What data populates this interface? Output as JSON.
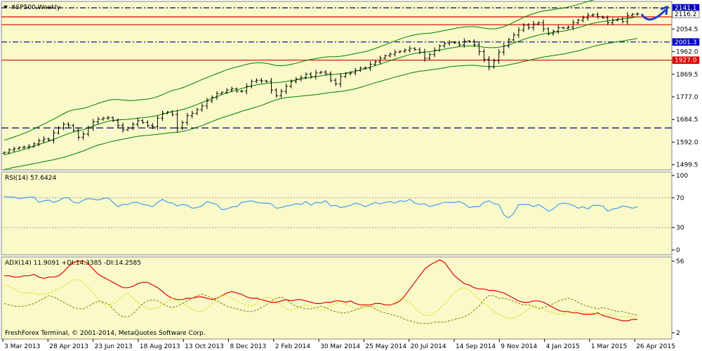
{
  "chart_data": [
    {
      "type": "ohlc",
      "title": "#SP500,Weekly",
      "y_ticks": [
        "2054.5",
        "1962.0",
        "1869.5",
        "1777.0",
        "1684.5",
        "1592.0",
        "1499.5"
      ],
      "ylim": [
        1490,
        2150
      ],
      "price_tags": [
        {
          "text": "2141.1",
          "value": 2141.1,
          "bg": "#0000c8",
          "fg": "#ffffff"
        },
        {
          "text": "2116.2",
          "value": 2116.2,
          "bg": "#ffffff",
          "fg": "#000000"
        },
        {
          "text": "2001.3",
          "value": 2001.3,
          "bg": "#0000c8",
          "fg": "#ffffff"
        },
        {
          "text": "1927.0",
          "value": 1927.0,
          "bg": "#e00000",
          "fg": "#ffffff"
        }
      ],
      "hlines": [
        {
          "value": 2141.1,
          "color": "#000080",
          "dash": "dashdot"
        },
        {
          "value": 2104.0,
          "color": "#e00000",
          "dash": "solid"
        },
        {
          "value": 2072.0,
          "color": "#e00000",
          "dash": "solid"
        },
        {
          "value": 2001.3,
          "color": "#000080",
          "dash": "dashdot"
        },
        {
          "value": 1927.0,
          "color": "#e00000",
          "dash": "solid"
        },
        {
          "value": 1650.0,
          "color": "#000080",
          "dash": "dash"
        }
      ],
      "close": [
        1550,
        1560,
        1565,
        1570,
        1572,
        1575,
        1585,
        1598,
        1605,
        1600,
        1630,
        1650,
        1665,
        1660,
        1640,
        1612,
        1625,
        1650,
        1675,
        1685,
        1690,
        1692,
        1680,
        1660,
        1642,
        1650,
        1665,
        1680,
        1672,
        1660,
        1655,
        1690,
        1710,
        1715,
        1705,
        1650,
        1672,
        1700,
        1710,
        1725,
        1740,
        1760,
        1775,
        1790,
        1796,
        1805,
        1810,
        1800,
        1800,
        1820,
        1840,
        1845,
        1842,
        1840,
        1805,
        1782,
        1800,
        1820,
        1840,
        1850,
        1856,
        1870,
        1860,
        1875,
        1878,
        1872,
        1845,
        1830,
        1860,
        1872,
        1875,
        1885,
        1895,
        1895,
        1910,
        1920,
        1935,
        1945,
        1952,
        1960,
        1963,
        1968,
        1975,
        1970,
        1960,
        1935,
        1950,
        1968,
        1985,
        1995,
        2000,
        1998,
        1990,
        2005,
        2003,
        1990,
        1962,
        1930,
        1900,
        1925,
        1960,
        1985,
        2010,
        2030,
        2050,
        2070,
        2060,
        2075,
        2080,
        2055,
        2035,
        2045,
        2060,
        2058,
        2062,
        2080,
        2090,
        2100,
        2110,
        2113,
        2105,
        2100,
        2080,
        2090,
        2095,
        2085,
        2110,
        2115,
        2116
      ],
      "bb_mid": [
        1540,
        1545,
        1551,
        1556,
        1562,
        1568,
        1575,
        1582,
        1589,
        1596,
        1603,
        1611,
        1619,
        1627,
        1633,
        1638,
        1643,
        1650,
        1658,
        1665,
        1671,
        1677,
        1681,
        1683,
        1684,
        1685,
        1687,
        1690,
        1692,
        1694,
        1697,
        1701,
        1706,
        1712,
        1717,
        1720,
        1725,
        1731,
        1738,
        1746,
        1754,
        1762,
        1770,
        1778,
        1786,
        1793,
        1799,
        1805,
        1811,
        1817,
        1822,
        1826,
        1829,
        1832,
        1834,
        1835,
        1837,
        1840,
        1843,
        1846,
        1850,
        1854,
        1857,
        1860,
        1863,
        1866,
        1868,
        1869,
        1871,
        1874,
        1878,
        1882,
        1887,
        1892,
        1898,
        1905,
        1911,
        1918,
        1925,
        1932,
        1938,
        1944,
        1950,
        1954,
        1958,
        1960,
        1962,
        1965,
        1968,
        1972,
        1976,
        1979,
        1982,
        1984,
        1985,
        1985,
        1983,
        1980,
        1978,
        1978,
        1980,
        1984,
        1990,
        1997,
        2004,
        2012,
        2018,
        2024,
        2030,
        2034,
        2037,
        2040,
        2043,
        2046,
        2050,
        2055,
        2060,
        2066,
        2072,
        2078,
        2082,
        2085,
        2088,
        2090,
        2093,
        2095,
        2098,
        2101,
        2104
      ],
      "bb_upper": [
        1600,
        1606,
        1613,
        1620,
        1628,
        1636,
        1646,
        1656,
        1666,
        1676,
        1686,
        1697,
        1708,
        1718,
        1724,
        1727,
        1730,
        1736,
        1743,
        1750,
        1757,
        1763,
        1766,
        1766,
        1764,
        1762,
        1762,
        1764,
        1766,
        1768,
        1772,
        1778,
        1786,
        1795,
        1803,
        1808,
        1814,
        1822,
        1830,
        1839,
        1848,
        1856,
        1864,
        1872,
        1880,
        1888,
        1894,
        1899,
        1904,
        1910,
        1914,
        1916,
        1916,
        1914,
        1910,
        1905,
        1904,
        1906,
        1910,
        1914,
        1920,
        1926,
        1930,
        1934,
        1937,
        1940,
        1941,
        1941,
        1943,
        1946,
        1950,
        1954,
        1958,
        1962,
        1968,
        1975,
        1982,
        1990,
        1998,
        2006,
        2013,
        2020,
        2026,
        2030,
        2034,
        2036,
        2037,
        2040,
        2044,
        2048,
        2052,
        2056,
        2060,
        2063,
        2064,
        2064,
        2062,
        2058,
        2055,
        2055,
        2058,
        2064,
        2072,
        2082,
        2092,
        2102,
        2110,
        2117,
        2124,
        2128,
        2131,
        2134,
        2137,
        2140,
        2144,
        2149,
        2155,
        2161,
        2167,
        2173,
        2176,
        2178,
        2180,
        2181,
        2183,
        2185,
        2187,
        2190,
        2192
      ],
      "bb_lower": [
        1480,
        1484,
        1489,
        1492,
        1496,
        1500,
        1504,
        1508,
        1512,
        1516,
        1520,
        1525,
        1530,
        1536,
        1542,
        1549,
        1556,
        1564,
        1573,
        1580,
        1585,
        1591,
        1596,
        1600,
        1604,
        1608,
        1612,
        1616,
        1618,
        1620,
        1622,
        1624,
        1626,
        1629,
        1631,
        1632,
        1636,
        1640,
        1646,
        1653,
        1660,
        1668,
        1676,
        1684,
        1692,
        1698,
        1704,
        1711,
        1718,
        1724,
        1730,
        1736,
        1742,
        1750,
        1758,
        1765,
        1770,
        1774,
        1776,
        1778,
        1780,
        1782,
        1784,
        1786,
        1789,
        1792,
        1795,
        1797,
        1799,
        1802,
        1806,
        1810,
        1816,
        1822,
        1828,
        1835,
        1840,
        1846,
        1852,
        1858,
        1863,
        1868,
        1874,
        1878,
        1882,
        1884,
        1887,
        1890,
        1892,
        1896,
        1900,
        1902,
        1904,
        1905,
        1906,
        1906,
        1904,
        1902,
        1901,
        1901,
        1902,
        1904,
        1908,
        1912,
        1916,
        1922,
        1926,
        1931,
        1936,
        1940,
        1943,
        1946,
        1949,
        1952,
        1956,
        1961,
        1965,
        1971,
        1977,
        1983,
        1988,
        1992,
        1996,
        1999,
        2003,
        2005,
        2009,
        2012,
        2016
      ]
    },
    {
      "type": "line",
      "title": "RSI(14) 57.6424",
      "ylim": [
        0,
        100
      ],
      "y_ticks": [
        "100",
        "70",
        "30",
        "0"
      ],
      "levels": [
        70,
        30
      ],
      "series": [
        {
          "values": [
            72,
            71,
            71,
            69,
            70,
            71,
            71,
            64,
            66,
            67,
            64,
            66,
            70,
            70,
            64,
            63,
            67,
            69,
            68,
            67,
            69,
            70,
            64,
            58,
            61,
            61,
            64,
            64,
            61,
            60,
            58,
            64,
            68,
            64,
            63,
            59,
            61,
            60,
            56,
            57,
            59,
            65,
            63,
            61,
            54,
            55,
            58,
            58,
            64,
            65,
            66,
            64,
            63,
            63,
            62,
            56,
            57,
            59,
            60,
            62,
            61,
            65,
            60,
            64,
            63,
            66,
            59,
            60,
            57,
            58,
            60,
            63,
            61,
            58,
            61,
            64,
            62,
            64,
            65,
            63,
            66,
            65,
            68,
            63,
            61,
            62,
            58,
            60,
            62,
            64,
            64,
            64,
            65,
            62,
            57,
            58,
            58,
            64,
            66,
            62,
            61,
            47,
            43,
            49,
            61,
            61,
            61,
            58,
            61,
            57,
            52,
            55,
            61,
            63,
            62,
            60,
            56,
            58,
            55,
            60,
            60,
            59,
            52,
            55,
            56,
            59,
            58,
            56,
            58
          ]
        }
      ]
    },
    {
      "type": "line",
      "title": "ADX(14) 11.9091 +DI:14.3385 -DI:14.2585",
      "ylim": [
        2,
        56
      ],
      "y_ticks": [
        "56",
        "2"
      ],
      "series": [
        {
          "values": [
            45,
            45,
            44,
            44,
            45,
            45,
            46,
            44,
            43,
            44,
            44,
            45,
            48,
            52,
            55,
            56,
            56,
            54,
            50,
            46,
            44,
            42,
            40,
            38,
            36,
            36,
            37,
            39,
            40,
            40,
            38,
            36,
            33,
            30,
            28,
            27,
            27,
            28,
            28,
            29,
            29,
            28,
            27,
            28,
            30,
            32,
            33,
            32,
            31,
            29,
            28,
            28,
            27,
            26,
            25,
            25,
            26,
            27,
            26,
            27,
            27,
            26,
            25,
            24,
            24,
            25,
            25,
            26,
            26,
            25,
            26,
            24,
            23,
            23,
            23,
            24,
            24,
            23,
            23,
            24,
            26,
            30,
            35,
            40,
            45,
            50,
            53,
            55,
            57,
            55,
            50,
            45,
            42,
            39,
            38,
            36,
            35,
            35,
            34,
            34,
            33,
            32,
            30,
            28,
            26,
            25,
            25,
            26,
            26,
            25,
            23,
            21,
            19,
            18,
            18,
            17,
            17,
            16,
            16,
            16,
            17,
            15,
            14,
            13,
            12,
            11,
            11,
            12,
            12
          ],
          "color": "#e00000",
          "dash": "solid"
        },
        {
          "values": [
            38,
            37,
            35,
            33,
            32,
            32,
            32,
            31,
            31,
            32,
            33,
            35,
            37,
            40,
            42,
            42,
            40,
            36,
            32,
            27,
            24,
            22,
            24,
            26,
            30,
            32,
            28,
            25,
            22,
            20,
            20,
            21,
            23,
            26,
            28,
            26,
            24,
            22,
            20,
            18,
            18,
            20,
            24,
            28,
            30,
            30,
            28,
            26,
            24,
            23,
            22,
            24,
            27,
            29,
            28,
            26,
            23,
            20,
            19,
            20,
            22,
            23,
            22,
            20,
            19,
            20,
            22,
            24,
            25,
            23,
            22,
            20,
            20,
            21,
            22,
            22,
            21,
            20,
            22,
            26,
            28,
            27,
            25,
            21,
            17,
            15,
            15,
            17,
            20,
            24,
            28,
            32,
            35,
            36,
            34,
            31,
            27,
            24,
            21,
            18,
            16,
            14,
            13,
            13,
            15,
            17,
            20,
            22,
            22,
            20,
            18,
            17,
            16,
            16,
            17,
            18,
            19,
            18,
            17,
            17,
            16,
            16,
            16,
            15,
            14,
            14,
            14,
            14,
            13
          ],
          "color": "#e0e000",
          "dash": "dash"
        },
        {
          "values": [
            24,
            23,
            22,
            22,
            22,
            23,
            24,
            26,
            28,
            30,
            29,
            27,
            25,
            23,
            21,
            20,
            20,
            22,
            24,
            26,
            25,
            24,
            20,
            16,
            14,
            14,
            16,
            20,
            24,
            26,
            27,
            26,
            24,
            22,
            21,
            22,
            24,
            26,
            28,
            30,
            31,
            30,
            28,
            26,
            24,
            22,
            21,
            20,
            19,
            18,
            18,
            19,
            21,
            23,
            26,
            28,
            29,
            27,
            24,
            22,
            21,
            20,
            20,
            21,
            22,
            21,
            19,
            18,
            17,
            17,
            18,
            19,
            21,
            22,
            22,
            20,
            18,
            17,
            16,
            15,
            14,
            12,
            11,
            10,
            9,
            9,
            9,
            10,
            10,
            10,
            11,
            12,
            13,
            14,
            16,
            19,
            22,
            27,
            30,
            30,
            28,
            28,
            27,
            26,
            24,
            23,
            23,
            22,
            20,
            21,
            22,
            24,
            26,
            27,
            28,
            27,
            25,
            23,
            22,
            21,
            20,
            21,
            20,
            19,
            18,
            18,
            17,
            16,
            15
          ],
          "color": "#808000",
          "dash": "dash"
        }
      ]
    }
  ],
  "x_labels": [
    "3 Mar 2013",
    "28 Apr 2013",
    "23 Jun 2013",
    "18 Aug 2013",
    "13 Oct 2013",
    "8 Dec 2013",
    "2 Feb 2014",
    "30 Mar 2014",
    "25 May 2014",
    "20 Jul 2014",
    "14 Sep 2014",
    "9 Nov 2014",
    "4 Jan 2015",
    "1 Mar 2015",
    "26 Apr 2015"
  ],
  "footer": "FreshForex Terminal, © 2001-2014, MetaQuotes Software Corp.",
  "colors": {
    "background": "#f9f9c9",
    "bars": "#000000",
    "bands": "#008000",
    "rsi": "#1e90ff",
    "tag_blue": "#0000c8",
    "tag_red": "#e00000"
  }
}
